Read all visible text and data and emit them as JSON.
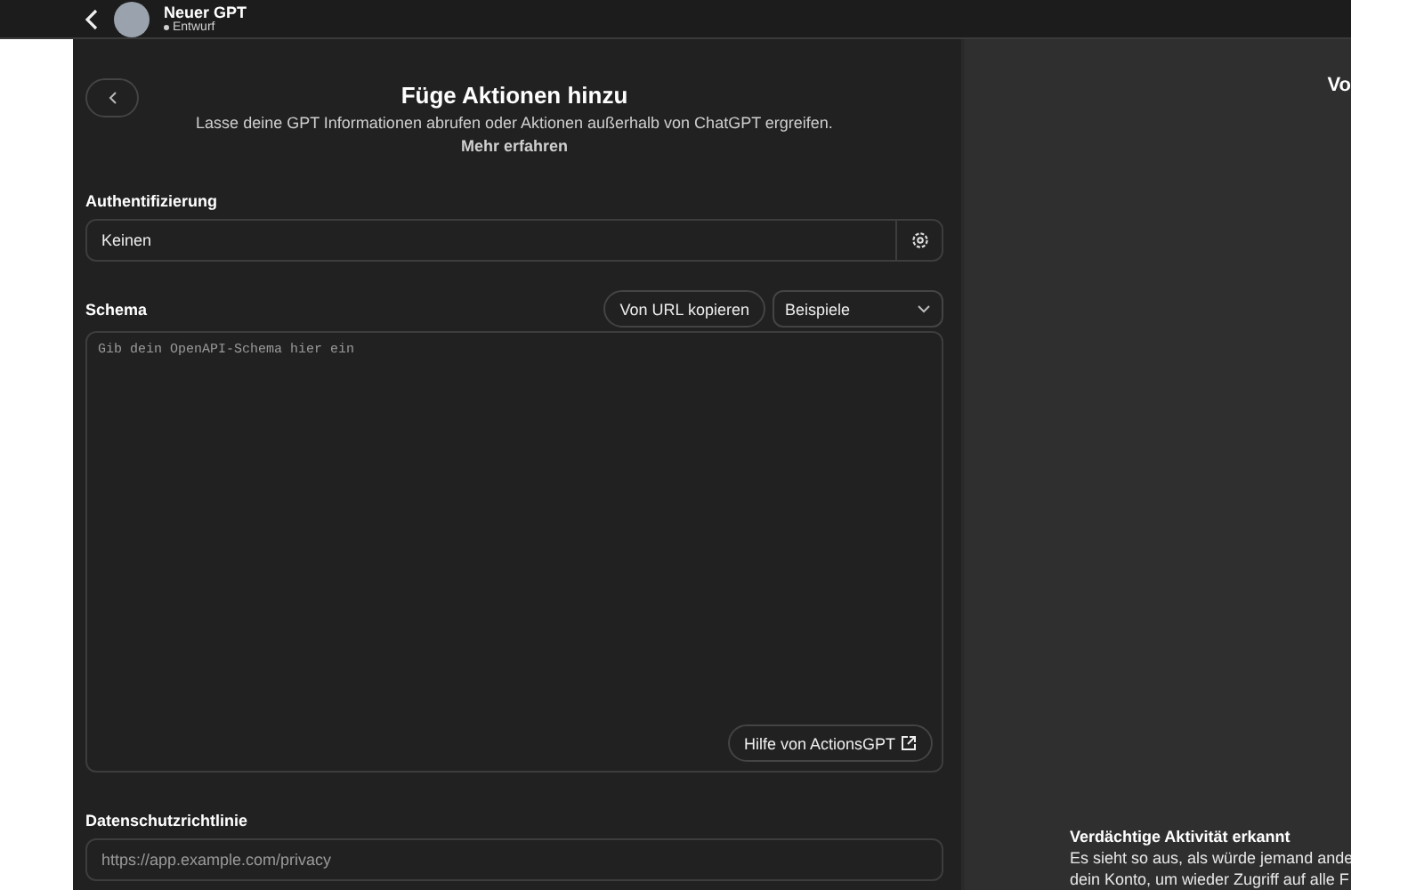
{
  "header": {
    "title": "Neuer GPT",
    "status": "Entwurf"
  },
  "editor": {
    "title": "Füge Aktionen hinzu",
    "subtitle": "Lasse deine GPT Informationen abrufen oder Aktionen außerhalb von ChatGPT ergreifen.",
    "learn_more": "Mehr erfahren",
    "authentication": {
      "label": "Authentifizierung",
      "value": "Keinen"
    },
    "schema": {
      "label": "Schema",
      "import_button": "Von URL kopieren",
      "examples_dropdown": "Beispiele",
      "placeholder": "Gib dein OpenAPI-Schema hier ein",
      "help_button": "Hilfe von ActionsGPT"
    },
    "privacy": {
      "label": "Datenschutzrichtlinie",
      "placeholder": "https://app.example.com/privacy"
    }
  },
  "preview": {
    "title": "Vo",
    "alert": {
      "title": "Verdächtige Aktivität erkannt",
      "lines": [
        "Es sieht so aus, als würde jemand ande",
        "dein Konto, um wieder Zugriff auf alle F"
      ]
    }
  }
}
